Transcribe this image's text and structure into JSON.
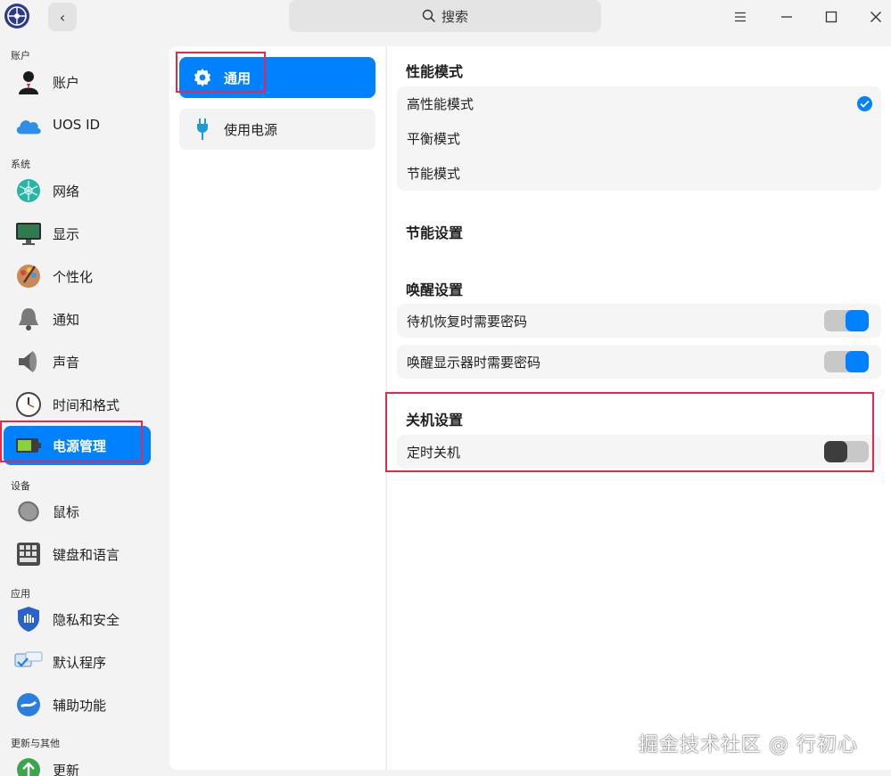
{
  "titlebar": {
    "search_placeholder": "搜索",
    "back_glyph": "‹",
    "menu_glyph": "☰",
    "minimize_glyph": "—",
    "maximize_glyph": "☐",
    "close_glyph": "✕"
  },
  "sidebar": {
    "sections": [
      {
        "title": "账户",
        "items": [
          {
            "label": "账户",
            "icon": "account-icon"
          },
          {
            "label": "UOS ID",
            "icon": "cloud-icon"
          }
        ]
      },
      {
        "title": "系统",
        "items": [
          {
            "label": "网络",
            "icon": "network-icon"
          },
          {
            "label": "显示",
            "icon": "display-icon"
          },
          {
            "label": "个性化",
            "icon": "personalization-icon"
          },
          {
            "label": "通知",
            "icon": "bell-icon"
          },
          {
            "label": "声音",
            "icon": "speaker-icon"
          },
          {
            "label": "时间和格式",
            "icon": "clock-icon"
          },
          {
            "label": "电源管理",
            "icon": "battery-icon",
            "active": true
          }
        ]
      },
      {
        "title": "设备",
        "items": [
          {
            "label": "鼠标",
            "icon": "mouse-icon"
          },
          {
            "label": "键盘和语言",
            "icon": "keyboard-icon"
          }
        ]
      },
      {
        "title": "应用",
        "items": [
          {
            "label": "隐私和安全",
            "icon": "shield-icon"
          },
          {
            "label": "默认程序",
            "icon": "default-apps-icon"
          },
          {
            "label": "辅助功能",
            "icon": "accessibility-icon"
          }
        ]
      },
      {
        "title": "更新与其他",
        "items": [
          {
            "label": "更新",
            "icon": "update-icon"
          }
        ]
      }
    ]
  },
  "middle": {
    "items": [
      {
        "label": "通用",
        "icon": "gear-icon",
        "active": true
      },
      {
        "label": "使用电源",
        "icon": "plug-icon"
      }
    ]
  },
  "content": {
    "performance": {
      "title": "性能模式",
      "options": [
        {
          "label": "高性能模式",
          "selected": true
        },
        {
          "label": "平衡模式",
          "selected": false
        },
        {
          "label": "节能模式",
          "selected": false
        }
      ]
    },
    "power_saving": {
      "title": "节能设置"
    },
    "wakeup": {
      "title": "唤醒设置",
      "settings": [
        {
          "label": "待机恢复时需要密码",
          "enabled": true
        },
        {
          "label": "唤醒显示器时需要密码",
          "enabled": true
        }
      ]
    },
    "shutdown": {
      "title": "关机设置",
      "settings": [
        {
          "label": "定时关机",
          "enabled": false
        }
      ]
    }
  },
  "watermark": "掘金技术社区 @ 行初心",
  "colors": {
    "accent": "#0081ff",
    "highlight": "#e8274b",
    "background": "#f3f3f3"
  }
}
